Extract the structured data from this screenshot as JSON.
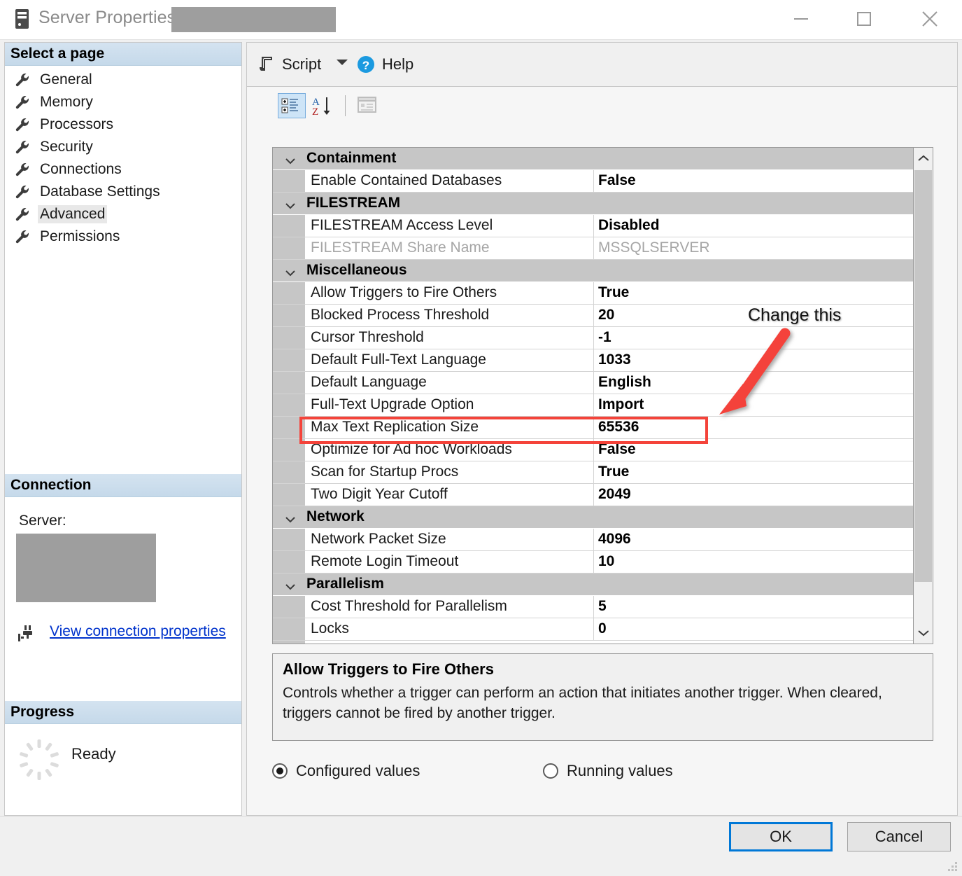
{
  "window": {
    "title": "Server Properties -",
    "icon": "server-icon",
    "controls": {
      "minimize": "minimize-icon",
      "maximize": "maximize-icon",
      "close": "close-icon"
    }
  },
  "sidebar": {
    "header": "Select a page",
    "items": [
      {
        "label": "General",
        "selected": false
      },
      {
        "label": "Memory",
        "selected": false
      },
      {
        "label": "Processors",
        "selected": false
      },
      {
        "label": "Security",
        "selected": false
      },
      {
        "label": "Connections",
        "selected": false
      },
      {
        "label": "Database Settings",
        "selected": false
      },
      {
        "label": "Advanced",
        "selected": true
      },
      {
        "label": "Permissions",
        "selected": false
      }
    ],
    "connection": {
      "header": "Connection",
      "server_label": "Server:",
      "link": "View connection properties"
    },
    "progress": {
      "header": "Progress",
      "status": "Ready"
    }
  },
  "toolbar": {
    "script_label": "Script",
    "script_icon": "script-icon",
    "script_caret": "chevron-down-icon",
    "help_label": "Help",
    "help_icon": "help-icon",
    "buttons": [
      {
        "name": "categorized-view-button",
        "selected": true
      },
      {
        "name": "alphabetical-sort-button",
        "selected": false
      },
      {
        "name": "property-pages-button",
        "selected": false
      }
    ]
  },
  "grid": {
    "categories": [
      {
        "name": "Containment",
        "properties": [
          {
            "name": "Enable Contained Databases",
            "value": "False",
            "disabled": false,
            "highlighted": false
          }
        ]
      },
      {
        "name": "FILESTREAM",
        "properties": [
          {
            "name": "FILESTREAM Access Level",
            "value": "Disabled",
            "disabled": false,
            "highlighted": false
          },
          {
            "name": "FILESTREAM Share Name",
            "value": "MSSQLSERVER",
            "disabled": true,
            "highlighted": false
          }
        ]
      },
      {
        "name": "Miscellaneous",
        "properties": [
          {
            "name": "Allow Triggers to Fire Others",
            "value": "True",
            "disabled": false,
            "highlighted": false
          },
          {
            "name": "Blocked Process Threshold",
            "value": "20",
            "disabled": false,
            "highlighted": false
          },
          {
            "name": "Cursor Threshold",
            "value": "-1",
            "disabled": false,
            "highlighted": false
          },
          {
            "name": "Default Full-Text Language",
            "value": "1033",
            "disabled": false,
            "highlighted": false
          },
          {
            "name": "Default Language",
            "value": "English",
            "disabled": false,
            "highlighted": false
          },
          {
            "name": "Full-Text Upgrade Option",
            "value": "Import",
            "disabled": false,
            "highlighted": false
          },
          {
            "name": "Max Text Replication Size",
            "value": "65536",
            "disabled": false,
            "highlighted": true
          },
          {
            "name": "Optimize for Ad hoc Workloads",
            "value": "False",
            "disabled": false,
            "highlighted": false
          },
          {
            "name": "Scan for Startup Procs",
            "value": "True",
            "disabled": false,
            "highlighted": false
          },
          {
            "name": "Two Digit Year Cutoff",
            "value": "2049",
            "disabled": false,
            "highlighted": false
          }
        ]
      },
      {
        "name": "Network",
        "properties": [
          {
            "name": "Network Packet Size",
            "value": "4096",
            "disabled": false,
            "highlighted": false
          },
          {
            "name": "Remote Login Timeout",
            "value": "10",
            "disabled": false,
            "highlighted": false
          }
        ]
      },
      {
        "name": "Parallelism",
        "properties": [
          {
            "name": "Cost Threshold for Parallelism",
            "value": "5",
            "disabled": false,
            "highlighted": false
          },
          {
            "name": "Locks",
            "value": "0",
            "disabled": false,
            "highlighted": false
          }
        ]
      }
    ]
  },
  "description": {
    "title": "Allow Triggers to Fire Others",
    "body": "Controls whether a trigger can perform an action that initiates another trigger. When cleared, triggers cannot be fired by another trigger."
  },
  "value_mode": {
    "configured": "Configured values",
    "running": "Running values",
    "selected": "Configured values"
  },
  "footer": {
    "ok": "OK",
    "cancel": "Cancel"
  },
  "annotations": {
    "callout_text": "Change this",
    "callout_color": "#f4433a"
  }
}
